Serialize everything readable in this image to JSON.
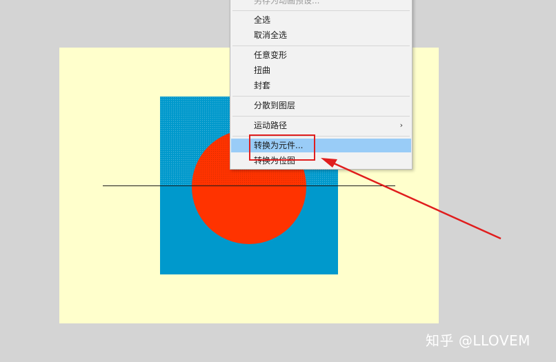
{
  "menu": {
    "items": [
      {
        "id": "partial-top",
        "label": "另存为动画预设...",
        "state": "disabled"
      },
      {
        "id": "select-all",
        "label": "全选"
      },
      {
        "id": "deselect-all",
        "label": "取消全选"
      },
      {
        "id": "free-transform",
        "label": "任意变形"
      },
      {
        "id": "distort",
        "label": "扭曲"
      },
      {
        "id": "envelope",
        "label": "封套"
      },
      {
        "id": "distribute-to-layers",
        "label": "分散到图层"
      },
      {
        "id": "motion-path",
        "label": "运动路径",
        "submenu_icon": "chevron-right-icon"
      },
      {
        "id": "convert-to-symbol",
        "label": "转换为元件...",
        "state": "highlighted"
      },
      {
        "id": "convert-to-bitmap",
        "label": "转换为位图"
      }
    ],
    "highlight_color": "#99ccf7"
  },
  "canvas": {
    "stage_color": "#ffffcc",
    "workspace_color": "#d4d4d4",
    "rectangle_color": "#0099cc",
    "circle_color": "#ff3300",
    "line_color": "#1a1a1a"
  },
  "annotation": {
    "box_color": "#e01d1d",
    "arrow_color": "#e01d1d",
    "target": "convert-to-symbol"
  },
  "watermark": {
    "text": "知乎 @LLOVEM"
  }
}
